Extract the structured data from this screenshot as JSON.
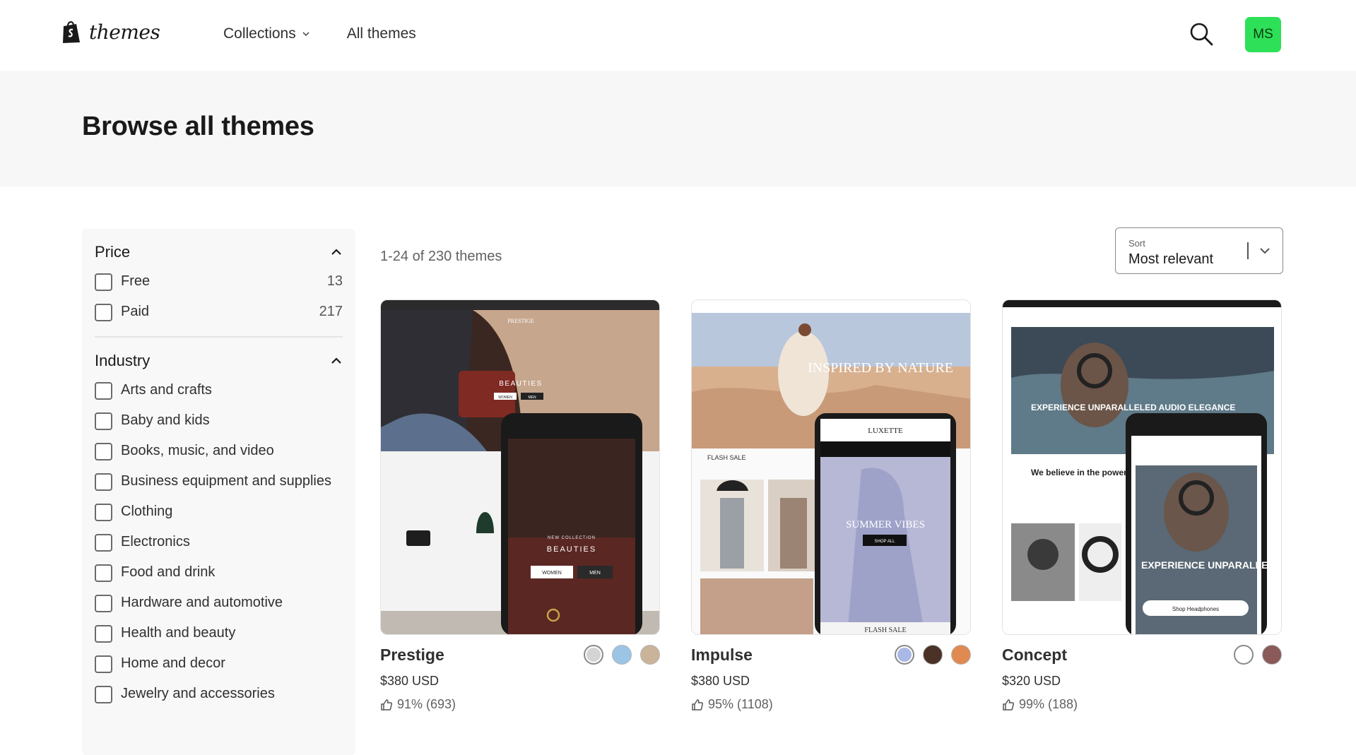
{
  "header": {
    "logo_text": "themes",
    "nav": [
      {
        "label": "Collections"
      },
      {
        "label": "All themes"
      }
    ],
    "avatar_initials": "MS"
  },
  "hero": {
    "title": "Browse all themes"
  },
  "filters": {
    "price": {
      "title": "Price",
      "options": [
        {
          "label": "Free",
          "count": "13"
        },
        {
          "label": "Paid",
          "count": "217"
        }
      ]
    },
    "industry": {
      "title": "Industry",
      "options": [
        {
          "label": "Arts and crafts"
        },
        {
          "label": "Baby and kids"
        },
        {
          "label": "Books, music, and video"
        },
        {
          "label": "Business equipment and supplies"
        },
        {
          "label": "Clothing"
        },
        {
          "label": "Electronics"
        },
        {
          "label": "Food and drink"
        },
        {
          "label": "Hardware and automotive"
        },
        {
          "label": "Health and beauty"
        },
        {
          "label": "Home and decor"
        },
        {
          "label": "Jewelry and accessories"
        }
      ]
    }
  },
  "results": {
    "count_text": "1-24 of 230 themes",
    "sort": {
      "label": "Sort",
      "value": "Most relevant"
    }
  },
  "themes": [
    {
      "name": "Prestige",
      "price": "$380 USD",
      "rating": "91% (693)",
      "swatches": [
        "#d4d4d4",
        "#9cc4e4",
        "#c9b49a"
      ],
      "preview": {
        "desktop_heading": "BEAUTIES",
        "desktop_buttons": [
          "WOMEN",
          "MEN"
        ],
        "desktop_brand": "PRESTIGE",
        "mobile_kicker": "NEW COLLECTION",
        "mobile_heading": "BEAUTIES",
        "mobile_buttons": [
          "WOMEN",
          "MEN"
        ]
      }
    },
    {
      "name": "Impulse",
      "price": "$380 USD",
      "rating": "95% (1108)",
      "swatches": [
        "#a9b8e6",
        "#4a3226",
        "#e08a52"
      ],
      "preview": {
        "desktop_heading": "INSPIRED BY NATURE",
        "desktop_section": "FLASH SALE",
        "mobile_brand": "LUXETTE",
        "mobile_heading": "SUMMER VIBES",
        "mobile_button": "SHOP ALL",
        "mobile_footer": "FLASH SALE"
      }
    },
    {
      "name": "Concept",
      "price": "$320 USD",
      "rating": "99% (188)",
      "swatches": [
        "#ffffff",
        "#8a5a5a"
      ],
      "preview": {
        "desktop_heading": "EXPERIENCE UNPARALLELED AUDIO ELEGANCE",
        "desktop_tagline": "We believe in the power of sound",
        "mobile_heading": "EXPERIENCE UNPARALLELED AUDIO ELEGANCE",
        "mobile_button": "Shop Headphones"
      }
    }
  ]
}
